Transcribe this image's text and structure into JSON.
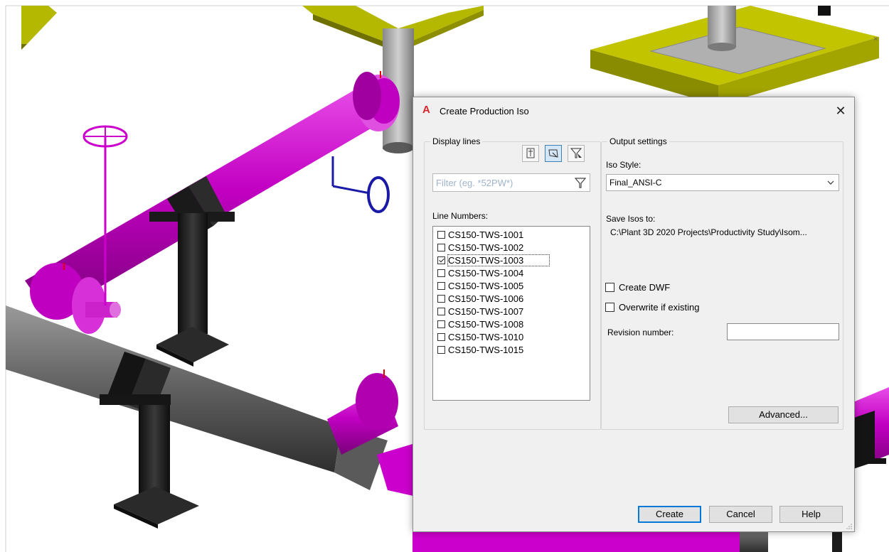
{
  "dialog": {
    "title": "Create Production Iso",
    "close_glyph": "✕"
  },
  "display_lines": {
    "legend": "Display lines",
    "filter_placeholder": "Filter (eg. *52PW*)",
    "line_numbers_label": "Line Numbers:",
    "lines": [
      {
        "label": "CS150-TWS-1001",
        "checked": false
      },
      {
        "label": "CS150-TWS-1002",
        "checked": false
      },
      {
        "label": "CS150-TWS-1003",
        "checked": true
      },
      {
        "label": "CS150-TWS-1004",
        "checked": false
      },
      {
        "label": "CS150-TWS-1005",
        "checked": false
      },
      {
        "label": "CS150-TWS-1006",
        "checked": false
      },
      {
        "label": "CS150-TWS-1007",
        "checked": false
      },
      {
        "label": "CS150-TWS-1008",
        "checked": false
      },
      {
        "label": "CS150-TWS-1010",
        "checked": false
      },
      {
        "label": "CS150-TWS-1015",
        "checked": false
      }
    ]
  },
  "output_settings": {
    "legend": "Output settings",
    "iso_style_label": "Iso Style:",
    "iso_style_value": "Final_ANSI-C",
    "save_isos_label": "Save Isos to:",
    "save_path": "C:\\Plant 3D 2020 Projects\\Productivity Study\\Isom...",
    "create_dwf_label": "Create DWF",
    "create_dwf_checked": false,
    "overwrite_label": "Overwrite if existing",
    "overwrite_checked": false,
    "revision_label": "Revision number:",
    "revision_value": "",
    "advanced_label": "Advanced..."
  },
  "buttons": {
    "create": "Create",
    "cancel": "Cancel",
    "help": "Help"
  },
  "colors": {
    "pipe_magenta": "#cc00cc",
    "pipe_gray": "#7a7a7a",
    "support_black": "#1c1c1c",
    "equipment_olive": "#b5b800",
    "valve_blue": "#1a1aa6"
  }
}
